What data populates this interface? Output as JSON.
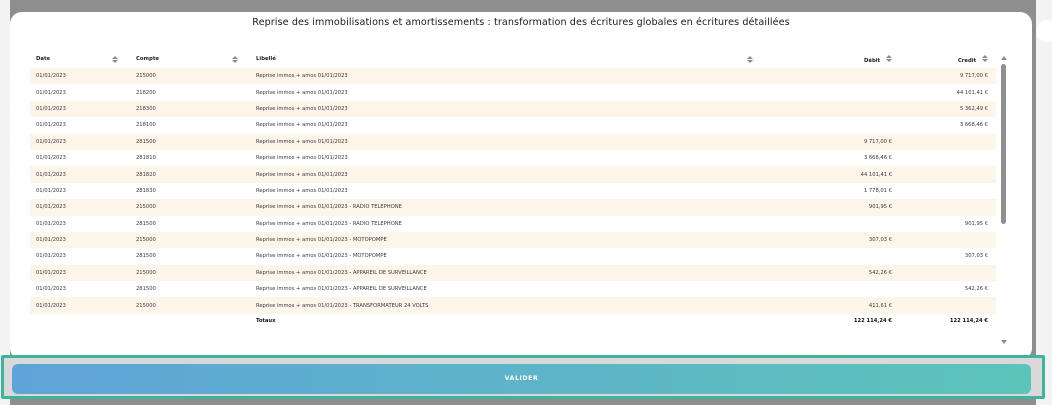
{
  "modal": {
    "title": "Reprise des immobilisations et amortissements : transformation des écritures globales en écritures détaillées"
  },
  "table": {
    "columns": {
      "date": "Date",
      "compte": "Compte",
      "libelle": "Libellé",
      "debit": "Débit",
      "credit": "Credit"
    },
    "rows": [
      {
        "date": "01/01/2023",
        "compte": "215000",
        "libelle": "Reprise immos + amos 01/01/2023",
        "debit": "",
        "credit": "9 717,00 €"
      },
      {
        "date": "01/01/2023",
        "compte": "218200",
        "libelle": "Reprise immos + amos 01/01/2023",
        "debit": "",
        "credit": "44 101,41 €"
      },
      {
        "date": "01/01/2023",
        "compte": "218300",
        "libelle": "Reprise immos + amos 01/01/2023",
        "debit": "",
        "credit": "5 362,49 €"
      },
      {
        "date": "01/01/2023",
        "compte": "218100",
        "libelle": "Reprise immos + amos 01/01/2023",
        "debit": "",
        "credit": "3 668,46 €"
      },
      {
        "date": "01/01/2023",
        "compte": "281500",
        "libelle": "Reprise immos + amos 01/01/2023",
        "debit": "9 717,00 €",
        "credit": ""
      },
      {
        "date": "01/01/2023",
        "compte": "281810",
        "libelle": "Reprise immos + amos 01/01/2023",
        "debit": "3 668,46 €",
        "credit": ""
      },
      {
        "date": "01/01/2023",
        "compte": "281820",
        "libelle": "Reprise immos + amos 01/01/2023",
        "debit": "44 101,41 €",
        "credit": ""
      },
      {
        "date": "01/01/2023",
        "compte": "281830",
        "libelle": "Reprise immos + amos 01/01/2023",
        "debit": "1 778,01 €",
        "credit": ""
      },
      {
        "date": "01/01/2023",
        "compte": "215000",
        "libelle": "Reprise immos + amos 01/01/2023 - RADIO TELEPHONE",
        "debit": "901,95 €",
        "credit": ""
      },
      {
        "date": "01/01/2023",
        "compte": "281500",
        "libelle": "Reprise immos + amos 01/01/2023 - RADIO TELEPHONE",
        "debit": "",
        "credit": "901,95 €"
      },
      {
        "date": "01/01/2023",
        "compte": "215000",
        "libelle": "Reprise immos + amos 01/01/2023 - MOTOPOMPE",
        "debit": "307,03 €",
        "credit": ""
      },
      {
        "date": "01/01/2023",
        "compte": "281500",
        "libelle": "Reprise immos + amos 01/01/2023 - MOTOPOMPE",
        "debit": "",
        "credit": "307,03 €"
      },
      {
        "date": "01/01/2023",
        "compte": "215000",
        "libelle": "Reprise immos + amos 01/01/2023 - APPAREIL DE SURVEILLANCE",
        "debit": "542,26 €",
        "credit": ""
      },
      {
        "date": "01/01/2023",
        "compte": "281500",
        "libelle": "Reprise immos + amos 01/01/2023 - APPAREIL DE SURVEILLANCE",
        "debit": "",
        "credit": "542,26 €"
      },
      {
        "date": "01/01/2023",
        "compte": "215000",
        "libelle": "Reprise immos + amos 01/01/2023 - TRANSFORMATEUR 24 VOLTS",
        "debit": "411,61 €",
        "credit": ""
      }
    ],
    "totals": {
      "label": "Totaux",
      "debit": "122 114,24 €",
      "credit": "122 114,24 €"
    }
  },
  "footer": {
    "valider_label": "VALIDER"
  },
  "colors": {
    "row_odd": "#fdf5ea",
    "frame_accent": "#3fb39b",
    "button_start": "#5fa4d9",
    "button_end": "#5cc4b9"
  }
}
